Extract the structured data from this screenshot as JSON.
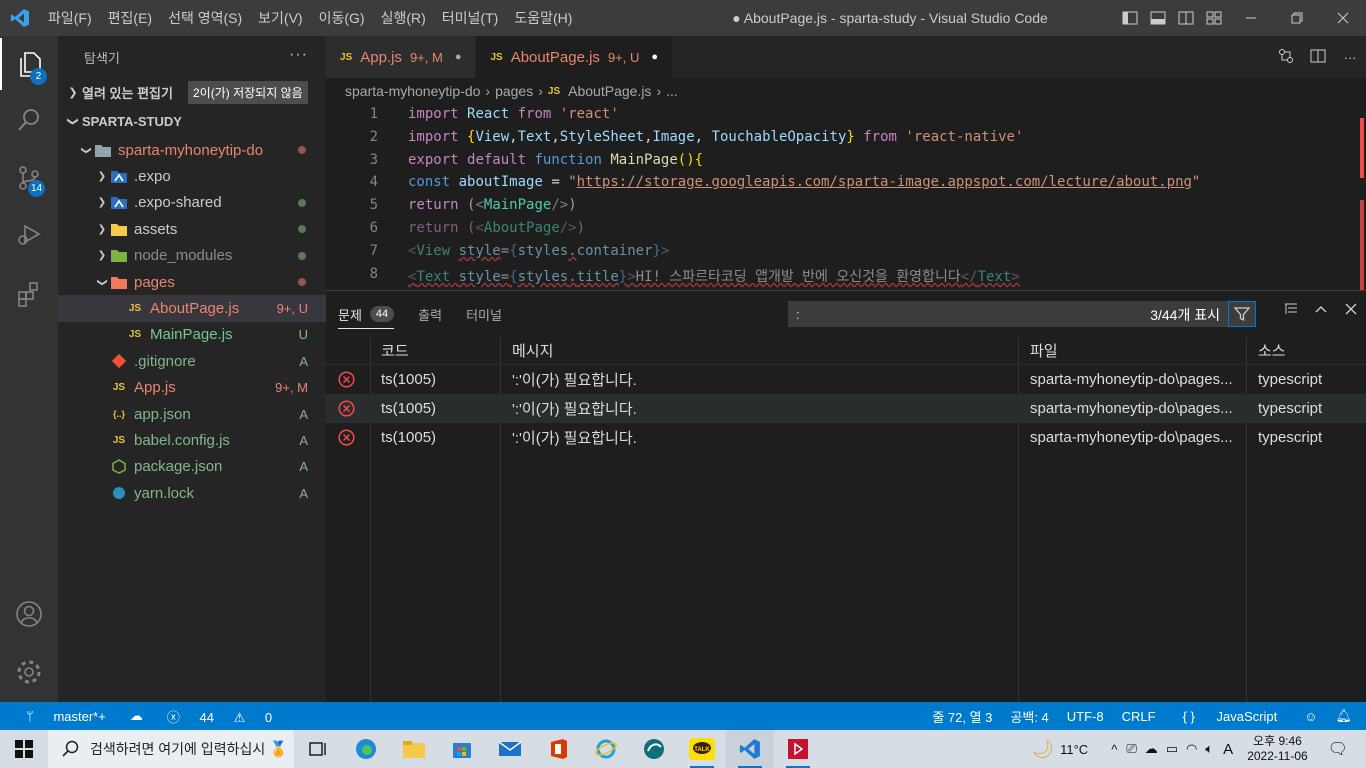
{
  "titlebar": {
    "menu": [
      "파일(F)",
      "편집(E)",
      "선택 영역(S)",
      "보기(V)",
      "이동(G)",
      "실행(R)",
      "터미널(T)",
      "도움말(H)"
    ],
    "title": "● AboutPage.js - sparta-study - Visual Studio Code"
  },
  "activity": {
    "explorer_badge": "2",
    "scm_badge": "14"
  },
  "sidebar": {
    "title": "탐색기",
    "open_editors": "열려 있는 편집기",
    "unsaved": "2이(가) 저장되지 않음",
    "workspace": "SPARTA-STUDY",
    "tree": [
      {
        "label": "sparta-myhoneytip-do",
        "status": "",
        "color": "#e8866f",
        "dot": "#8b5a50"
      },
      {
        "label": ".expo",
        "status": "",
        "color": "#cccccc",
        "dot": ""
      },
      {
        "label": ".expo-shared",
        "status": "",
        "color": "#cccccc",
        "dot": "#5a7a5a"
      },
      {
        "label": "assets",
        "status": "",
        "color": "#cccccc",
        "dot": "#5a7a5a"
      },
      {
        "label": "node_modules",
        "status": "",
        "color": "#8c8c8c",
        "dot": "#5a7a5a"
      },
      {
        "label": "pages",
        "status": "",
        "color": "#e8866f",
        "dot": "#8b5a50"
      },
      {
        "label": "AboutPage.js",
        "status": "9+, U",
        "color": "#e8866f",
        "dot": ""
      },
      {
        "label": "MainPage.js",
        "status": "U",
        "color": "#73c991",
        "dot": ""
      },
      {
        "label": ".gitignore",
        "status": "A",
        "color": "#81b88b",
        "dot": ""
      },
      {
        "label": "App.js",
        "status": "9+, M",
        "color": "#e8866f",
        "dot": ""
      },
      {
        "label": "app.json",
        "status": "A",
        "color": "#81b88b",
        "dot": ""
      },
      {
        "label": "babel.config.js",
        "status": "A",
        "color": "#81b88b",
        "dot": ""
      },
      {
        "label": "package.json",
        "status": "A",
        "color": "#81b88b",
        "dot": ""
      },
      {
        "label": "yarn.lock",
        "status": "A",
        "color": "#81b88b",
        "dot": ""
      }
    ]
  },
  "tabs": [
    {
      "label": "App.js",
      "status": "9+, M"
    },
    {
      "label": "AboutPage.js",
      "status": "9+, U"
    }
  ],
  "breadcrumb": {
    "folder": "sparta-myhoneytip-do",
    "sub": "pages",
    "file": "AboutPage.js",
    "rest": "..."
  },
  "code": {
    "line_numbers": [
      "1",
      "2",
      "3",
      "4",
      "5",
      "6",
      "7",
      "8"
    ]
  },
  "panel": {
    "tabs": {
      "problems": "문제",
      "problems_count": "44",
      "output": "출력",
      "terminal": "터미널"
    },
    "filter_value": ":",
    "filter_count": "3/44개 표시",
    "headers": {
      "code": "코드",
      "message": "메시지",
      "file": "파일",
      "source": "소스"
    },
    "rows": [
      {
        "code": "ts(1005)",
        "message": "':'이(가) 필요합니다.",
        "file": "sparta-myhoneytip-do\\pages...",
        "source": "typescript"
      },
      {
        "code": "ts(1005)",
        "message": "':'이(가) 필요합니다.",
        "file": "sparta-myhoneytip-do\\pages...",
        "source": "typescript"
      },
      {
        "code": "ts(1005)",
        "message": "':'이(가) 필요합니다.",
        "file": "sparta-myhoneytip-do\\pages...",
        "source": "typescript"
      }
    ]
  },
  "statusbar": {
    "branch": "master*+",
    "errors": "44",
    "warnings": "0",
    "position": "줄 72, 열 3",
    "spaces": "공백: 4",
    "encoding": "UTF-8",
    "eol": "CRLF",
    "language": "JavaScript"
  },
  "taskbar": {
    "search": "검색하려면 여기에 입력하십시",
    "temp": "11°C",
    "ime": "A",
    "time": "오후 9:46",
    "date": "2022-11-06"
  }
}
